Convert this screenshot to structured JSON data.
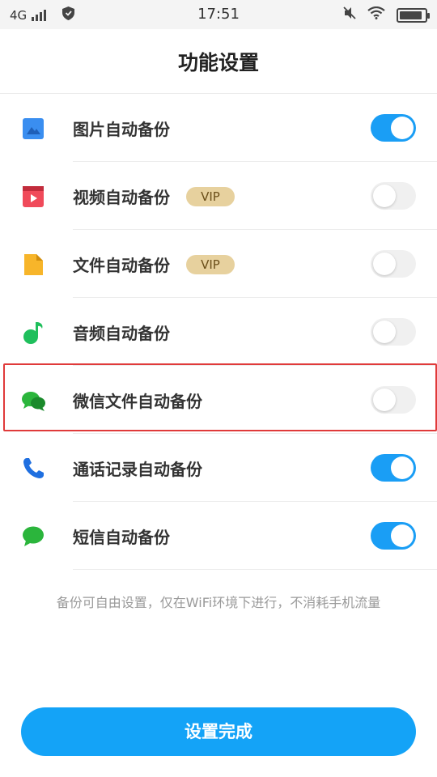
{
  "status_bar": {
    "network": "4G",
    "time": "17:51",
    "battery_level": 0.9
  },
  "header": {
    "title": "功能设置"
  },
  "settings": [
    {
      "label": "图片自动备份",
      "vip": false,
      "vip_label": "",
      "enabled": true,
      "icon": "picture-icon",
      "color": "#3a8ef0"
    },
    {
      "label": "视频自动备份",
      "vip": true,
      "vip_label": "VIP",
      "enabled": false,
      "icon": "video-icon",
      "color": "#f04a5a"
    },
    {
      "label": "文件自动备份",
      "vip": true,
      "vip_label": "VIP",
      "enabled": false,
      "icon": "file-icon",
      "color": "#f7b52a"
    },
    {
      "label": "音频自动备份",
      "vip": false,
      "vip_label": "",
      "enabled": false,
      "icon": "music-icon",
      "color": "#1fbf5c"
    },
    {
      "label": "微信文件自动备份",
      "vip": false,
      "vip_label": "",
      "enabled": false,
      "icon": "wechat-icon",
      "color": "#2bb53c",
      "highlighted": true
    },
    {
      "label": "通话记录自动备份",
      "vip": false,
      "vip_label": "",
      "enabled": true,
      "icon": "phone-icon",
      "color": "#1f6fe0"
    },
    {
      "label": "短信自动备份",
      "vip": false,
      "vip_label": "",
      "enabled": true,
      "icon": "sms-icon",
      "color": "#2bb53c"
    }
  ],
  "note": "备份可自由设置，仅在WiFi环境下进行，不消耗手机流量",
  "done_button": "设置完成",
  "colors": {
    "accent": "#14a3f7",
    "toggle_on": "#1a9ef5",
    "highlight_border": "#e03a3a",
    "vip_badge": "#e7d19e"
  }
}
